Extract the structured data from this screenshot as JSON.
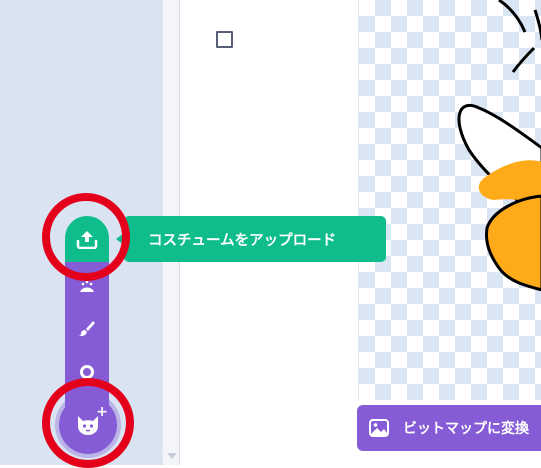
{
  "tooltip": {
    "text": "コスチュームをアップロード"
  },
  "canvas": {
    "convert_button_label": "ビットマップに変換"
  },
  "colors": {
    "accent": "#855cd6",
    "upload_green": "#0fbd8c",
    "highlight_red": "#e4001b",
    "left_pane": "#d9e3f2"
  },
  "icons": {
    "upload": "upload-icon",
    "surprise": "surprise-icon",
    "paint": "paint-brush-icon",
    "search": "search-icon",
    "main": "cat-icon",
    "select": "select-tool-icon",
    "image": "image-icon"
  }
}
